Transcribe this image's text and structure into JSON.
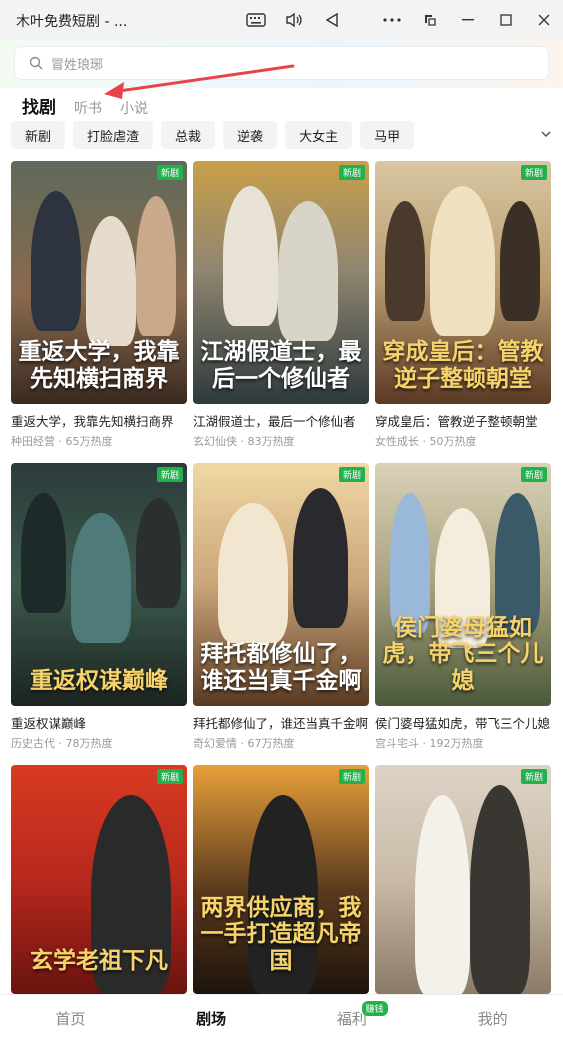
{
  "window": {
    "title": "木叶免费短剧 - ..."
  },
  "search": {
    "placeholder": "冒姓琅琊"
  },
  "tabs": [
    {
      "label": "找剧",
      "active": true
    },
    {
      "label": "听书",
      "active": false
    },
    {
      "label": "小说",
      "active": false
    }
  ],
  "categories": [
    "新剧",
    "打脸虐渣",
    "总裁",
    "逆袭",
    "大女主",
    "马甲"
  ],
  "badge_new": "新剧",
  "cards": [
    {
      "title": "重返大学，我靠先知横扫商界",
      "genre": "种田经营",
      "heat": "65万热度",
      "poster_text": "重返大学，我靠先知横扫商界",
      "bg": "#8a6a4e"
    },
    {
      "title": "江湖假道士，最后一个修仙者",
      "genre": "玄幻仙侠",
      "heat": "83万热度",
      "poster_text": "江湖假道士，最后一个修仙者",
      "bg": "#8f8570"
    },
    {
      "title": "穿成皇后：管教逆子整顿朝堂",
      "genre": "女性成长",
      "heat": "50万热度",
      "poster_text": "穿成皇后：管教逆子整顿朝堂",
      "bg": "#b89a6e"
    },
    {
      "title": "重返权谋巅峰",
      "genre": "历史古代",
      "heat": "78万热度",
      "poster_text": "重返权谋巅峰",
      "bg": "#3c5a4e"
    },
    {
      "title": "拜托都修仙了，谁还当真千金啊",
      "genre": "奇幻爱情",
      "heat": "67万热度",
      "poster_text": "拜托都修仙了，谁还当真千金啊",
      "bg": "#caa579"
    },
    {
      "title": "侯门婆母猛如虎，带飞三个儿媳",
      "genre": "宫斗宅斗",
      "heat": "192万热度",
      "poster_text": "侯门婆母猛如虎，带飞三个儿媳",
      "bg": "#a9a17d"
    },
    {
      "title": "玄学老祖下凡",
      "genre": "",
      "heat": "",
      "poster_text": "玄学老祖下凡",
      "bg": "#b8281c"
    },
    {
      "title": "两界供应商，我一手打造超凡帝国",
      "genre": "",
      "heat": "",
      "poster_text": "两界供应商，我一手打造超凡帝国",
      "bg": "#5a3a1e"
    },
    {
      "title": "",
      "genre": "",
      "heat": "",
      "poster_text": "",
      "bg": "#c9bba7"
    }
  ],
  "bottom_nav": [
    {
      "label": "首页",
      "active": false
    },
    {
      "label": "剧场",
      "active": true
    },
    {
      "label": "福利",
      "active": false,
      "badge": "赚钱"
    },
    {
      "label": "我的",
      "active": false
    }
  ],
  "colors": {
    "accent_green": "#22b14c",
    "annotation_arrow": "#e8424a"
  }
}
